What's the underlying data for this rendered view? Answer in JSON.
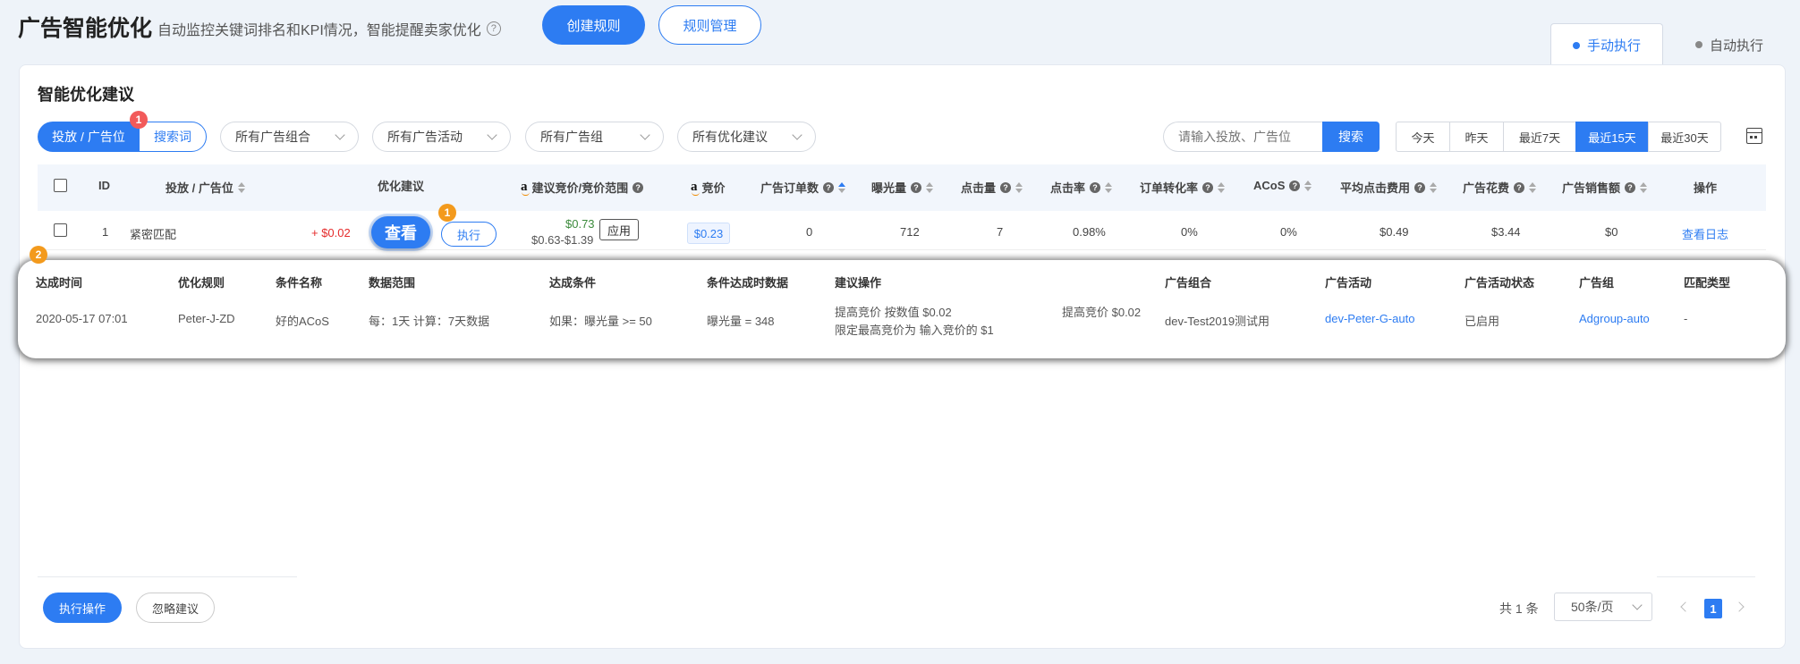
{
  "header": {
    "title": "广告智能优化",
    "subtitle": "自动监控关键词排名和KPI情况，智能提醒卖家优化",
    "create_rule": "创建规则",
    "manage_rule": "规则管理"
  },
  "mode_tabs": {
    "manual": "手动执行",
    "auto": "自动执行"
  },
  "card_title": "智能优化建议",
  "filters": {
    "seg_targeting": "投放 / 广告位",
    "seg_search": "搜索词",
    "seg_badge": "1",
    "dropdowns": [
      "所有广告组合",
      "所有广告活动",
      "所有广告组",
      "所有优化建议"
    ],
    "search_placeholder": "请输入投放、广告位",
    "search_button": "搜索"
  },
  "date_range": {
    "options": [
      "今天",
      "昨天",
      "最近7天",
      "最近15天",
      "最近30天"
    ],
    "selected": "最近15天"
  },
  "table": {
    "headers": {
      "id": "ID",
      "target": "投放 / 广告位",
      "suggestion": "优化建议",
      "bid_range": "建议竞价/竞价范围",
      "bid": "竞价",
      "orders": "广告订单数",
      "impressions": "曝光量",
      "clicks": "点击量",
      "ctr": "点击率",
      "cvr": "订单转化率",
      "acos": "ACoS",
      "cpc": "平均点击费用",
      "spend": "广告花费",
      "sales": "广告销售额",
      "action": "操作"
    },
    "row": {
      "id": "1",
      "target": "紧密匹配",
      "delta": "+ $0.02",
      "view": "查看",
      "execute": "执行",
      "exec_badge": "1",
      "suggested_bid": "$0.73",
      "bid_range": "$0.63-$1.39",
      "apply": "应用",
      "bid": "$0.23",
      "orders": "0",
      "impressions": "712",
      "clicks": "7",
      "ctr": "0.98%",
      "cvr": "0%",
      "acos": "0%",
      "cpc": "$0.49",
      "spend": "$3.44",
      "sales": "$0",
      "log": "查看日志"
    }
  },
  "detail": {
    "badge": "2",
    "headers": [
      "达成时间",
      "优化规则",
      "条件名称",
      "数据范围",
      "达成条件",
      "条件达成时数据",
      "建议操作",
      "广告组合",
      "广告活动",
      "广告活动状态",
      "广告组",
      "匹配类型"
    ],
    "row": {
      "time": "2020-05-17 07:01",
      "rule": "Peter-J-ZD",
      "cond_name": "好的ACoS",
      "range": "每：1天 计算：7天数据",
      "condition": "如果：曝光量 >= 50",
      "data": "曝光量 = 348",
      "op_line1": "提高竞价 按数值 $0.02",
      "op_line2": "限定最高竞价为 输入竞价的 $1",
      "op_side": "提高竞价 $0.02",
      "portfolio": "dev-Test2019测试用",
      "campaign": "dev-Peter-G-auto",
      "status": "已启用",
      "adgroup": "Adgroup-auto",
      "match": "-"
    }
  },
  "footer": {
    "execute": "执行操作",
    "ignore": "忽略建议",
    "total": "共 1 条",
    "page_size": "50条/页",
    "page": "1"
  },
  "colors": {
    "primary": "#2d7cf2",
    "badge_red": "#f25a5a",
    "badge_orange": "#f39a1d",
    "price_red": "#e52b2b",
    "price_green": "#3b8a3b"
  }
}
